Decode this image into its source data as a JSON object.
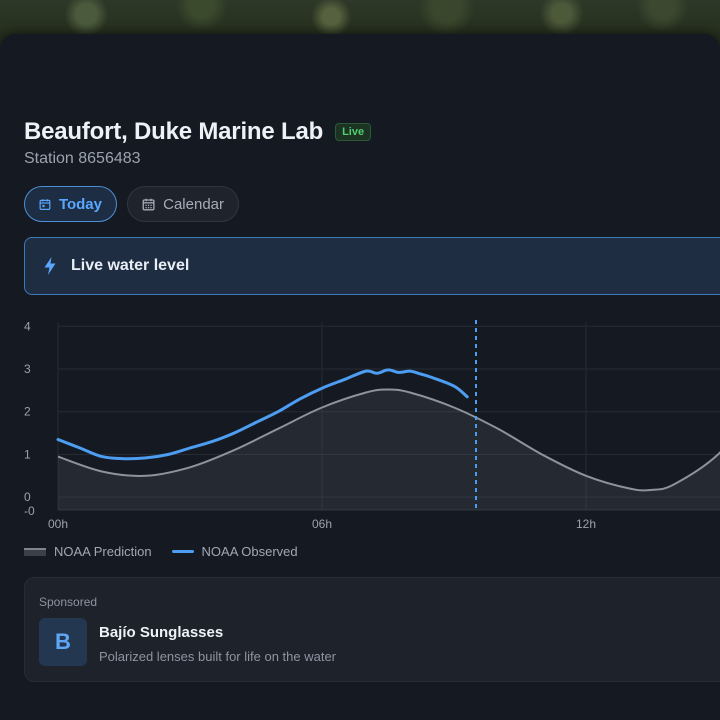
{
  "station": {
    "name": "Beaufort, Duke Marine Lab",
    "badge": "Live",
    "id_label": "Station 8656483"
  },
  "tabs": [
    {
      "label": "Today",
      "icon": "calendar-today-icon",
      "active": true
    },
    {
      "label": "Calendar",
      "icon": "calendar-icon",
      "active": false
    }
  ],
  "banner": {
    "label": "Live water level",
    "icon": "bolt-icon"
  },
  "legend": {
    "prediction": "NOAA Prediction",
    "observed": "NOAA Observed"
  },
  "colors": {
    "accent": "#4d9df2",
    "live_green": "#4fce6d",
    "prediction": "#8e939b"
  },
  "chart_data": {
    "type": "line",
    "x_unit": "hours",
    "xlim": [
      0,
      16
    ],
    "ylim": [
      -0.3,
      4.1
    ],
    "y_ticks": [
      "-0",
      "0",
      "1",
      "2",
      "3",
      "4"
    ],
    "x_ticks": [
      {
        "x": 0,
        "label": "00h"
      },
      {
        "x": 6,
        "label": "06h"
      },
      {
        "x": 12,
        "label": "12h"
      }
    ],
    "current_time": 9.5,
    "grid": true,
    "legend_position": "bottom-left",
    "series": [
      {
        "name": "NOAA Prediction",
        "style": "filled-line",
        "x": [
          0,
          1,
          2,
          3,
          4,
          5,
          6,
          7,
          7.5,
          8,
          9,
          10,
          11,
          12,
          13,
          13.5,
          14,
          15,
          16
        ],
        "values": [
          0.95,
          0.6,
          0.5,
          0.7,
          1.1,
          1.6,
          2.1,
          2.45,
          2.52,
          2.45,
          2.1,
          1.6,
          1.0,
          0.5,
          0.2,
          0.17,
          0.3,
          1.0,
          2.2
        ]
      },
      {
        "name": "NOAA Observed",
        "style": "line",
        "x": [
          0,
          0.5,
          1,
          1.5,
          2,
          2.5,
          3,
          3.5,
          4,
          4.5,
          5,
          5.5,
          6,
          6.5,
          7,
          7.25,
          7.5,
          7.75,
          8,
          8.25,
          8.5,
          9,
          9.3
        ],
        "values": [
          1.35,
          1.15,
          0.95,
          0.9,
          0.92,
          1.0,
          1.15,
          1.3,
          1.5,
          1.75,
          2.0,
          2.3,
          2.55,
          2.75,
          2.95,
          2.9,
          2.98,
          2.92,
          2.95,
          2.88,
          2.8,
          2.6,
          2.35
        ]
      }
    ]
  },
  "ad": {
    "sponsored_label": "Sponsored",
    "logo_letter": "B",
    "name": "Bajío Sunglasses",
    "description": "Polarized lenses built for life on the water"
  }
}
